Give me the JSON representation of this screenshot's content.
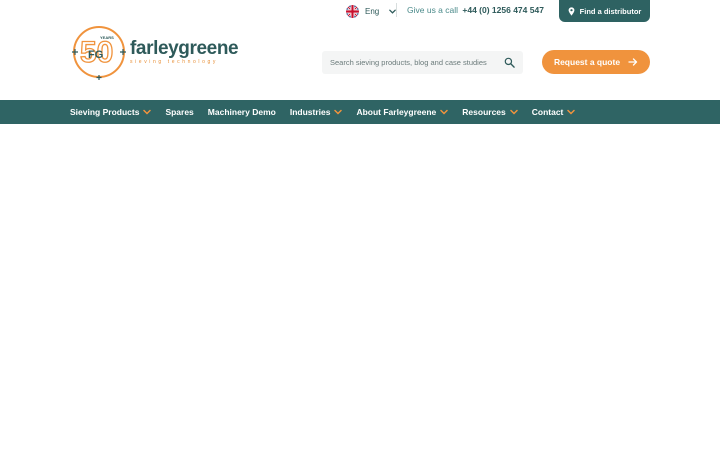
{
  "topbar": {
    "language": "Eng",
    "call_text": "Give us a call",
    "phone": "+44 (0) 1256 474 547",
    "distributor_label": "Find a distributor"
  },
  "logo": {
    "badge_number": "50",
    "badge_years": "YEARS",
    "badge_initials": "FG",
    "brand": "farleygreene",
    "tagline": "sieving technology"
  },
  "search": {
    "placeholder": "Search sieving products, blog and case studies"
  },
  "quote": {
    "label": "Request a quote"
  },
  "nav": {
    "items": [
      {
        "label": "Sieving Products",
        "has_dropdown": true
      },
      {
        "label": "Spares",
        "has_dropdown": false
      },
      {
        "label": "Machinery Demo",
        "has_dropdown": false
      },
      {
        "label": "Industries",
        "has_dropdown": true
      },
      {
        "label": "About Farleygreene",
        "has_dropdown": true
      },
      {
        "label": "Resources",
        "has_dropdown": true
      },
      {
        "label": "Contact",
        "has_dropdown": true
      }
    ]
  },
  "colors": {
    "primary_teal": "#2f6464",
    "accent_orange": "#f0933d"
  }
}
